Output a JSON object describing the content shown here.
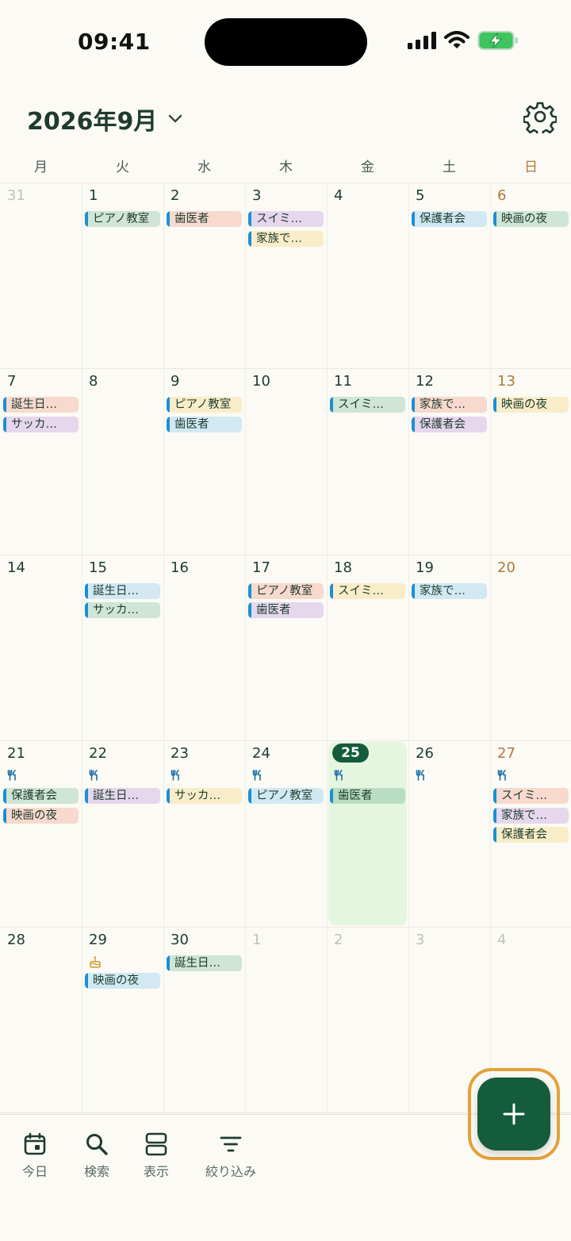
{
  "status": {
    "time": "09:41"
  },
  "header": {
    "month_label": "2026年9月"
  },
  "weekdays": [
    "月",
    "火",
    "水",
    "木",
    "金",
    "土",
    "日"
  ],
  "colors": {
    "accent": "#145c3c",
    "fab_ring": "#e5a13a",
    "sunday": "#b07a3a",
    "today_bg": "#e5f6df",
    "event_bar": "#1a8fd6"
  },
  "today": "25",
  "weeks": [
    {
      "days": [
        {
          "n": "31",
          "muted": true,
          "events": []
        },
        {
          "n": "1",
          "events": [
            {
              "t": "ピアノ教室",
              "c": "green"
            }
          ]
        },
        {
          "n": "2",
          "events": [
            {
              "t": "歯医者",
              "c": "salmon"
            }
          ]
        },
        {
          "n": "3",
          "events": [
            {
              "t": "スイミ…",
              "c": "purple"
            },
            {
              "t": "家族で…",
              "c": "yellow"
            }
          ]
        },
        {
          "n": "4",
          "events": []
        },
        {
          "n": "5",
          "events": [
            {
              "t": "保護者会",
              "c": "blue"
            }
          ]
        },
        {
          "n": "6",
          "sun": true,
          "events": [
            {
              "t": "映画の夜",
              "c": "green"
            }
          ]
        }
      ]
    },
    {
      "days": [
        {
          "n": "7",
          "events": [
            {
              "t": "誕生日…",
              "c": "salmon"
            },
            {
              "t": "サッカ…",
              "c": "purple"
            }
          ]
        },
        {
          "n": "8",
          "events": []
        },
        {
          "n": "9",
          "events": [
            {
              "t": "ピアノ教室",
              "c": "yellow"
            },
            {
              "t": "歯医者",
              "c": "blue"
            }
          ]
        },
        {
          "n": "10",
          "events": []
        },
        {
          "n": "11",
          "events": [
            {
              "t": "スイミ…",
              "c": "green"
            }
          ]
        },
        {
          "n": "12",
          "events": [
            {
              "t": "家族で…",
              "c": "salmon"
            },
            {
              "t": "保護者会",
              "c": "purple"
            }
          ]
        },
        {
          "n": "13",
          "sun": true,
          "events": [
            {
              "t": "映画の夜",
              "c": "yellow"
            }
          ]
        }
      ]
    },
    {
      "days": [
        {
          "n": "14",
          "events": []
        },
        {
          "n": "15",
          "events": [
            {
              "t": "誕生日…",
              "c": "blue"
            },
            {
              "t": "サッカ…",
              "c": "green"
            }
          ]
        },
        {
          "n": "16",
          "events": []
        },
        {
          "n": "17",
          "events": [
            {
              "t": "ピアノ教室",
              "c": "salmon"
            },
            {
              "t": "歯医者",
              "c": "purple"
            }
          ]
        },
        {
          "n": "18",
          "events": [
            {
              "t": "スイミ…",
              "c": "yellow"
            }
          ]
        },
        {
          "n": "19",
          "events": [
            {
              "t": "家族で…",
              "c": "blue"
            }
          ]
        },
        {
          "n": "20",
          "sun": true,
          "events": []
        }
      ]
    },
    {
      "days": [
        {
          "n": "21",
          "mark": "fork-knife-icon",
          "events": [
            {
              "t": "保護者会",
              "c": "green"
            },
            {
              "t": "映画の夜",
              "c": "salmon"
            }
          ]
        },
        {
          "n": "22",
          "mark": "fork-knife-icon",
          "events": [
            {
              "t": "誕生日…",
              "c": "purple"
            }
          ]
        },
        {
          "n": "23",
          "mark": "fork-knife-icon",
          "events": [
            {
              "t": "サッカ…",
              "c": "yellow"
            }
          ]
        },
        {
          "n": "24",
          "mark": "fork-knife-icon",
          "events": [
            {
              "t": "ピアノ教室",
              "c": "blue"
            }
          ]
        },
        {
          "n": "25",
          "today": true,
          "mark": "fork-knife-icon",
          "events": [
            {
              "t": "歯医者",
              "c": "gdark"
            }
          ]
        },
        {
          "n": "26",
          "mark": "fork-knife-icon",
          "events": []
        },
        {
          "n": "27",
          "sun": true,
          "mark": "fork-knife-icon",
          "events": [
            {
              "t": "スイミ…",
              "c": "salmon"
            },
            {
              "t": "家族で…",
              "c": "purple"
            },
            {
              "t": "保護者会",
              "c": "yellow"
            }
          ]
        }
      ]
    },
    {
      "days": [
        {
          "n": "28",
          "events": []
        },
        {
          "n": "29",
          "mark": "birthday-cake-icon",
          "events": [
            {
              "t": "映画の夜",
              "c": "blue"
            }
          ]
        },
        {
          "n": "30",
          "events": [
            {
              "t": "誕生日…",
              "c": "green"
            }
          ]
        },
        {
          "n": "1",
          "muted": true,
          "events": []
        },
        {
          "n": "2",
          "muted": true,
          "events": []
        },
        {
          "n": "3",
          "muted": true,
          "events": []
        },
        {
          "n": "4",
          "muted": true,
          "events": []
        }
      ]
    }
  ],
  "tabs": [
    {
      "label": "今日",
      "icon": "calendar-today-icon"
    },
    {
      "label": "検索",
      "icon": "search-icon"
    },
    {
      "label": "表示",
      "icon": "view-layout-icon"
    },
    {
      "label": "絞り込み",
      "icon": "filter-icon"
    }
  ],
  "fab": {
    "icon": "plus-icon"
  }
}
